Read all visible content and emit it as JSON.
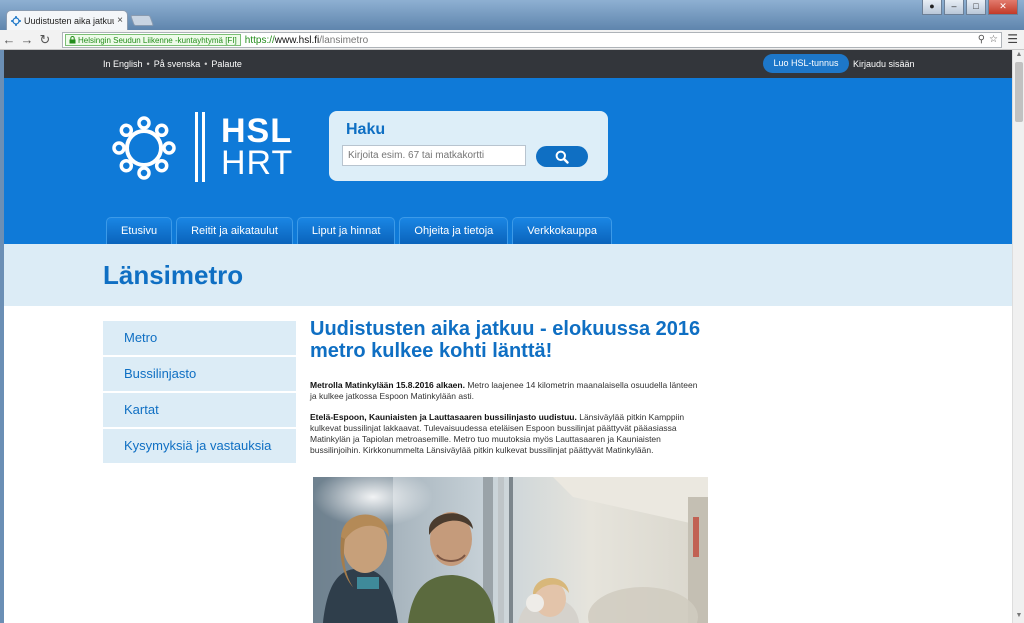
{
  "browser": {
    "tab_title": "Uudistusten aika jatkuu - e",
    "tab_close": "×",
    "ev_label": "Helsingin Seudun Liikenne -kuntayhtymä [FI]",
    "url_scheme": "https://",
    "url_host": "www.hsl.fi",
    "url_path": "/lansimetro"
  },
  "utility": {
    "links": [
      "In English",
      "På svenska",
      "Palaute"
    ],
    "create_account": "Luo HSL-tunnus",
    "login": "Kirjaudu sisään"
  },
  "header": {
    "logo_top": "HSL",
    "logo_bottom": "HRT",
    "search_title": "Haku",
    "search_placeholder": "Kirjoita esim. 67 tai matkakortti"
  },
  "nav": [
    "Etusivu",
    "Reitit ja aikataulut",
    "Liput ja hinnat",
    "Ohjeita ja tietoja",
    "Verkkokauppa"
  ],
  "page": {
    "title": "Länsimetro"
  },
  "sidebar": [
    "Metro",
    "Bussilinjasto",
    "Kartat",
    "Kysymyksiä ja vastauksia"
  ],
  "article": {
    "title": "Uudistusten aika jatkuu - elokuussa 2016 metro kulkee kohti länttä!",
    "p1_bold": "Metrolla Matinkylään 15.8.2016 alkaen.",
    "p1_text": " Metro laajenee 14 kilometrin maanalaisella osuudella länteen ja kulkee jatkossa Espoon Matinkylään asti.",
    "p2_bold": "Etelä-Espoon, Kauniaisten ja Lauttasaaren bussilinjasto uudistuu.",
    "p2_text": " Länsiväylää pitkin Kamppiin kulkevat bussilinjat lakkaavat. Tulevaisuudessa eteläisen Espoon bussilinjat päättyvät pääasiassa Matinkylän ja Tapiolan metroasemille. Metro tuo muutoksia myös Lauttasaaren ja Kauniaisten bussilinjoihin. Kirkkonummelta Länsiväylää pitkin kulkevat bussilinjat päättyvät Matinkylään."
  },
  "colors": {
    "brand_blue": "#0f7ad8",
    "link_blue": "#0f6fc3",
    "light_band": "#dcecf6",
    "utility_bar": "#33363b"
  }
}
